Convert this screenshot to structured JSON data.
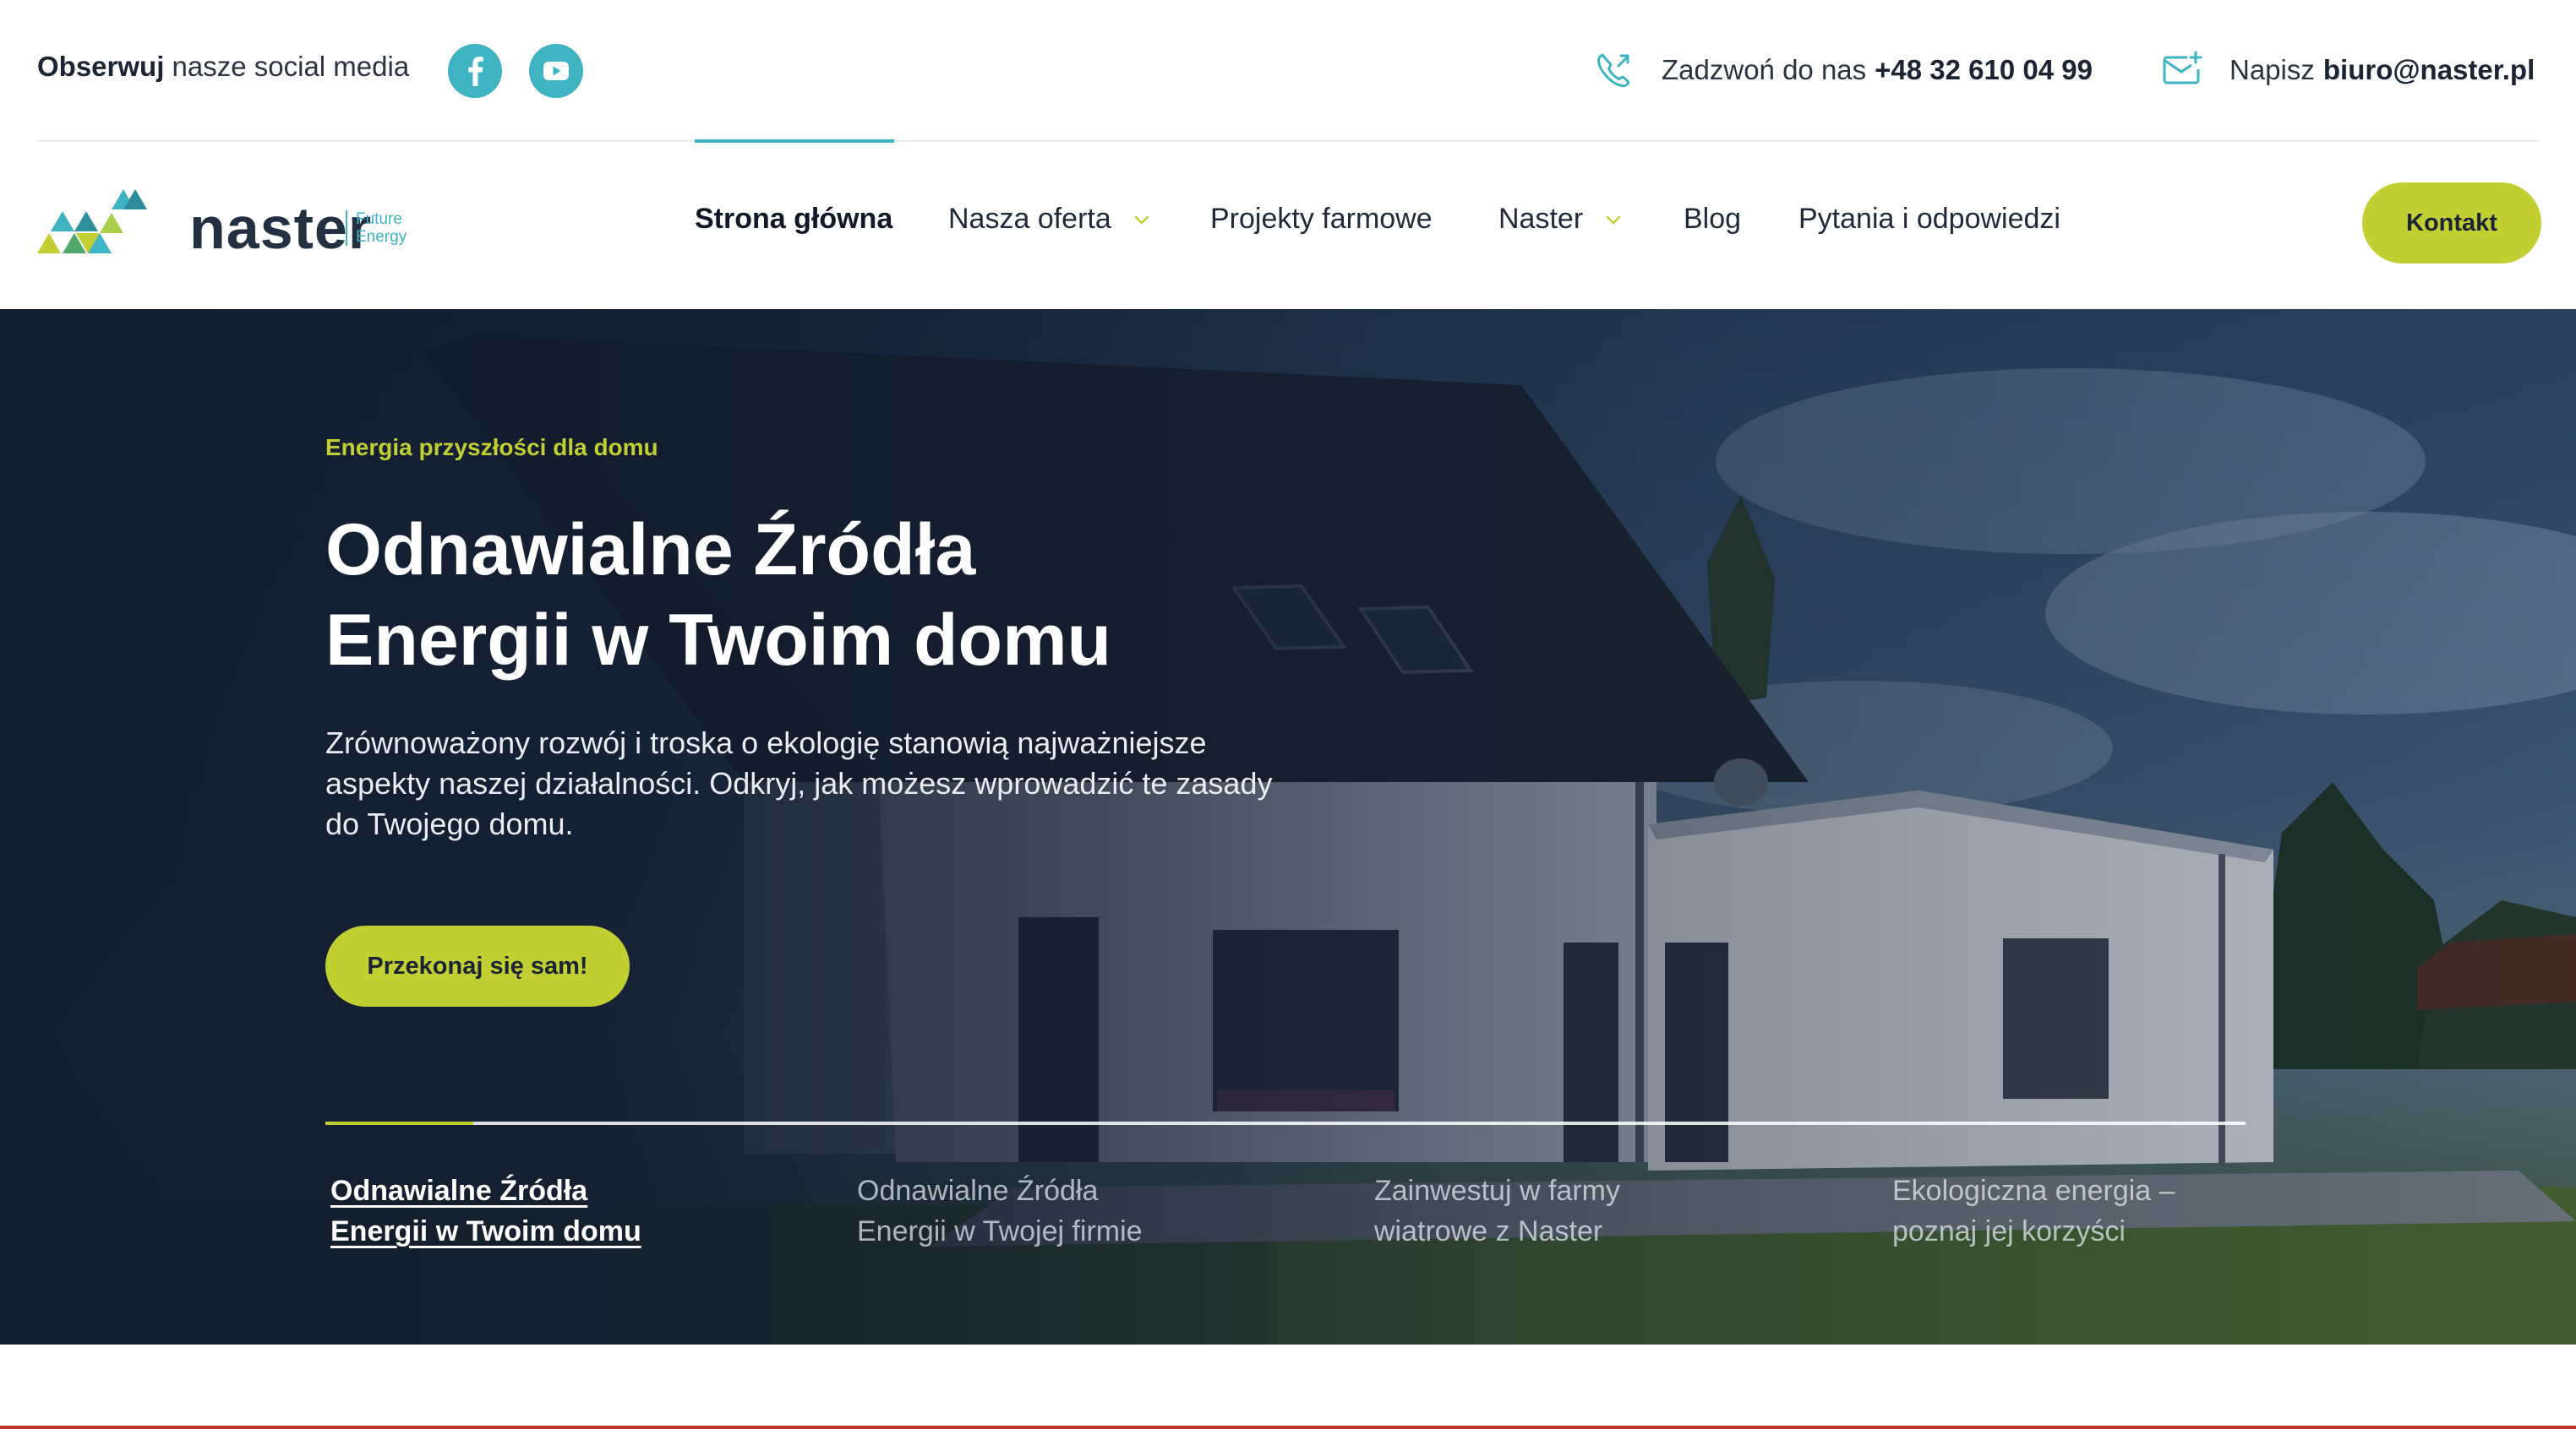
{
  "topbar": {
    "follow_bold": "Obserwuj",
    "follow_rest": "nasze social media",
    "social_icons": [
      "facebook-icon",
      "youtube-icon"
    ],
    "phone_label": "Zadzwoń do nas",
    "phone_number": "+48 32 610 04 99",
    "email_label": "Napisz",
    "email_address": "biuro@naster.pl"
  },
  "logo": {
    "name": "naster",
    "tagline_1": "Future",
    "tagline_2": "Energy"
  },
  "nav": {
    "items": [
      {
        "label": "Strona główna",
        "active": true,
        "dropdown": false
      },
      {
        "label": "Nasza oferta",
        "active": false,
        "dropdown": true
      },
      {
        "label": "Projekty farmowe",
        "active": false,
        "dropdown": false
      },
      {
        "label": "Naster",
        "active": false,
        "dropdown": true
      },
      {
        "label": "Blog",
        "active": false,
        "dropdown": false
      },
      {
        "label": "Pytania i odpowiedzi",
        "active": false,
        "dropdown": false
      }
    ],
    "contact_button": "Kontakt"
  },
  "hero": {
    "eyebrow": "Energia przyszłości dla domu",
    "title_line_1": "Odnawialne Źródła",
    "title_line_2": "Energii w Twoim domu",
    "description": "Zrównoważony rozwój i troska o ekologię stanowią najważniejsze aspekty naszej działalności. Odkryj, jak możesz wprowadzić te zasady do Twojego domu.",
    "cta": "Przekonaj się sam!",
    "slider_progress_fraction": 0.077,
    "slides": [
      {
        "line_1": "Odnawialne Źródła",
        "line_2": "Energii w Twoim domu",
        "active": true
      },
      {
        "line_1": "Odnawialne Źródła",
        "line_2": "Energii w Twojej firmie",
        "active": false
      },
      {
        "line_1": "Zainwestuj w farmy",
        "line_2": "wiatrowe z Naster",
        "active": false
      },
      {
        "line_1": "Ekologiczna energia –",
        "line_2": "poznaj jej korzyści",
        "active": false
      }
    ]
  },
  "colors": {
    "accent_lime": "#c2cf33",
    "accent_teal": "#3eb3c2",
    "hero_navy": "#111c2e",
    "text_dark": "#1b2433"
  }
}
